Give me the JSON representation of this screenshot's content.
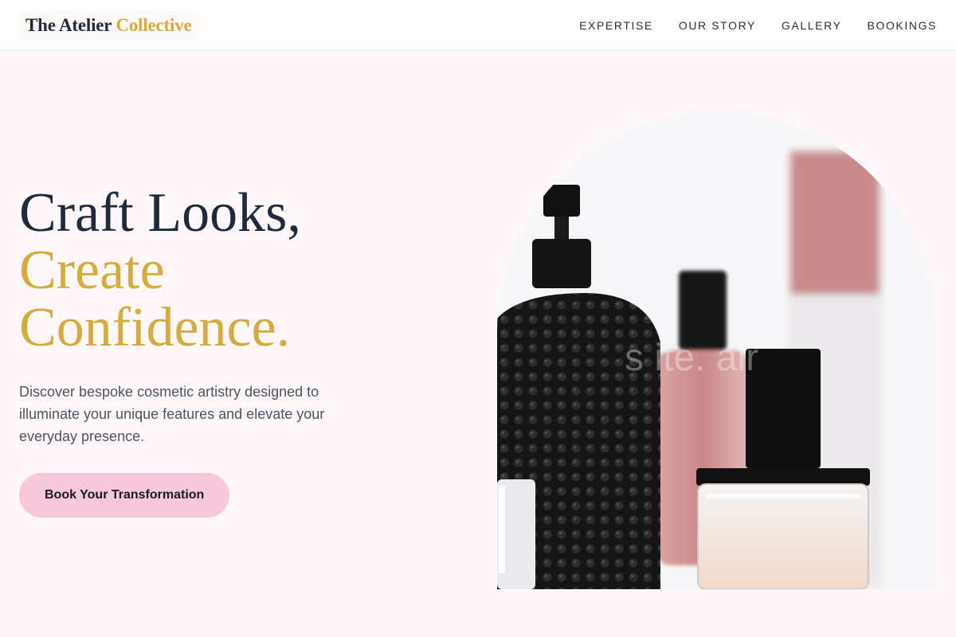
{
  "brand": {
    "name_part1": "The Atelier",
    "name_part2": "Collective"
  },
  "nav": {
    "items": [
      {
        "label": "EXPERTISE"
      },
      {
        "label": "OUR STORY"
      },
      {
        "label": "GALLERY"
      },
      {
        "label": "BOOKINGS"
      }
    ]
  },
  "hero": {
    "headline_line1": "Craft Looks,",
    "headline_line2": "Create",
    "headline_line3": "Confidence.",
    "subtitle": "Discover bespoke cosmetic artistry designed to illuminate your unique features and elevate your everyday presence.",
    "cta_label": "Book Your Transformation",
    "image_watermark": "s  ite.  air"
  },
  "colors": {
    "accent_gold": "#d4ab3c",
    "navy": "#1f2a3c",
    "cta_pink": "#f7c8dc",
    "page_bg": "#fdf7f9"
  }
}
